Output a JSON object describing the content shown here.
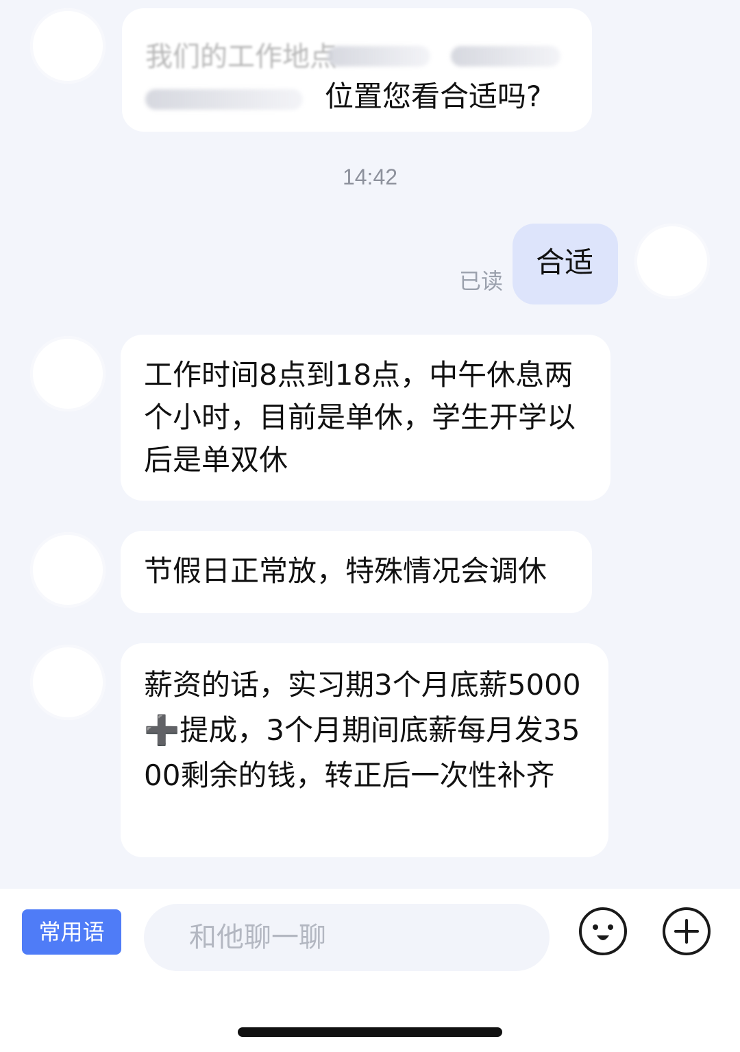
{
  "messages": [
    {
      "sender": "other",
      "text": "位置您看合适吗?",
      "obscured": true,
      "visible_fragments": [
        "我们的工作地点"
      ]
    },
    {
      "type": "timestamp",
      "text": "14:42"
    },
    {
      "sender": "me",
      "text": "合适",
      "status": "已读"
    },
    {
      "sender": "other",
      "text": "工作时间8点到18点，中午休息两个小时，目前是单休，学生开学以后是单双休"
    },
    {
      "sender": "other",
      "text": "节假日正常放，特殊情况会调休"
    },
    {
      "sender": "other",
      "text": "薪资的话，实习期3个月底薪5000➕提成，3个月期间底薪每月发3500剩余的钱，转正后一次性补齐"
    }
  ],
  "input_bar": {
    "phrase_button_label": "常用语",
    "input_placeholder": "和他聊一聊",
    "emoji_icon": "emoji-face-icon",
    "add_icon": "plus-circle-icon"
  },
  "colors": {
    "background": "#f3f5fb",
    "bubble_other": "#ffffff",
    "bubble_me": "#dde4fb",
    "accent": "#4f7cf7"
  }
}
